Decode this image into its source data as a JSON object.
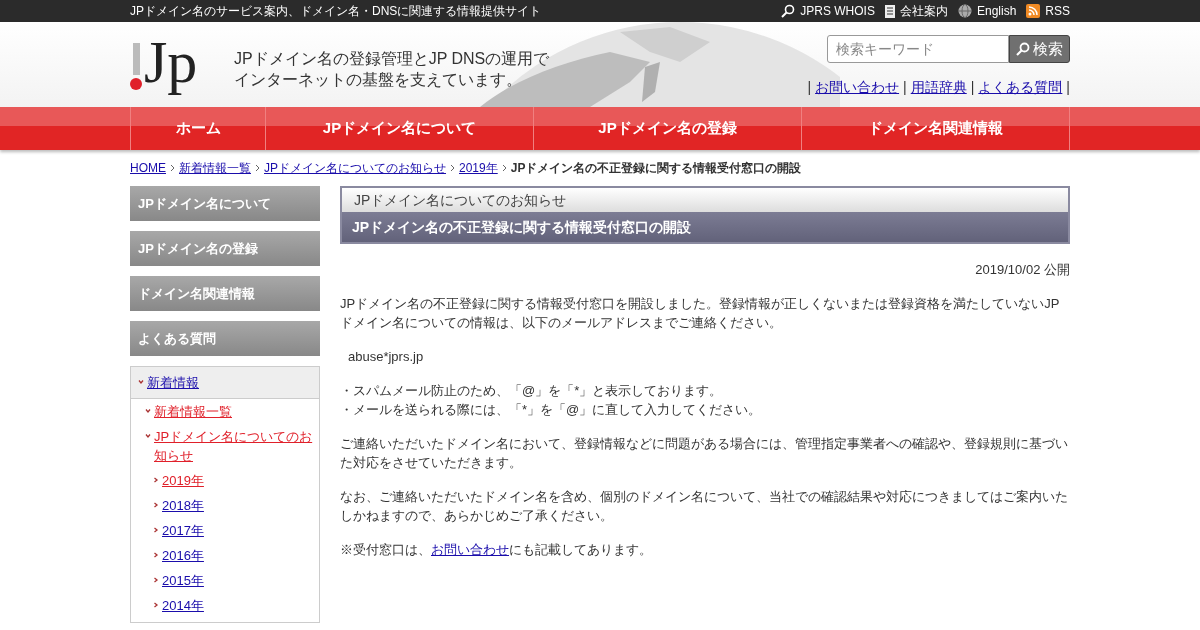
{
  "top_bar": {
    "tagline": "JPドメイン名のサービス案内、ドメイン名・DNSに関連する情報提供サイト",
    "links": [
      {
        "kind": "search",
        "label": "JPRS WHOIS"
      },
      {
        "kind": "document",
        "label": "会社案内"
      },
      {
        "kind": "globe",
        "label": "English"
      },
      {
        "kind": "rss",
        "label": "RSS"
      }
    ]
  },
  "header": {
    "logo": "Jp",
    "slogan": [
      "JPドメイン名の登録管理とJP DNSの運用で",
      "インターネットの基盤を支えています。"
    ],
    "search": {
      "placeholder": "検索キーワード",
      "button": "検索"
    },
    "links": [
      "お問い合わせ",
      "用語辞典",
      "よくある質問"
    ],
    "separator": "|"
  },
  "nav": [
    "ホーム",
    "JPドメイン名について",
    "JPドメイン名の登録",
    "ドメイン名関連情報"
  ],
  "breadcrumb": {
    "links": [
      "HOME",
      "新着情報一覧",
      "JPドメイン名についてのお知らせ",
      "2019年"
    ],
    "current": "JPドメイン名の不正登録に関する情報受付窓口の開設"
  },
  "sidebar": {
    "menu": [
      "JPドメイン名について",
      "JPドメイン名の登録",
      "ドメイン名関連情報",
      "よくある質問"
    ],
    "tree": [
      {
        "label": "新着情報",
        "selected": false,
        "expanded": true,
        "children": [
          {
            "label": "新着情報一覧",
            "selected": true,
            "expanded": true
          },
          {
            "label": "JPドメイン名についてのお知らせ",
            "selected": true,
            "expanded": true,
            "children": [
              {
                "label": "2019年",
                "selected": true,
                "expanded": false
              },
              {
                "label": "2018年",
                "selected": false,
                "expanded": false
              },
              {
                "label": "2017年",
                "selected": false,
                "expanded": false
              },
              {
                "label": "2016年",
                "selected": false,
                "expanded": false
              },
              {
                "label": "2015年",
                "selected": false,
                "expanded": false
              },
              {
                "label": "2014年",
                "selected": false,
                "expanded": false
              }
            ]
          }
        ]
      }
    ]
  },
  "article": {
    "category": "JPドメイン名についてのお知らせ",
    "title": "JPドメイン名の不正登録に関する情報受付窓口の開設",
    "date": "2019/10/02 公開",
    "blocks": [
      {
        "kind": "paragraph",
        "text": "JPドメイン名の不正登録に関する情報受付窓口を開設しました。登録情報が正しくないまたは登録資格を満たしていないJPドメイン名についての情報は、以下のメールアドレスまでご連絡ください。"
      },
      {
        "kind": "address",
        "text": "abuse*jprs.jp"
      },
      {
        "kind": "notes",
        "lines": [
          "・スパムメール防止のため、「@」を「*」と表示しております。",
          "・メールを送られる際には、「*」を「@」に直して入力してください。"
        ]
      },
      {
        "kind": "paragraph",
        "text": "ご連絡いただいたドメイン名において、登録情報などに問題がある場合には、管理指定事業者への確認や、登録規則に基づいた対応をさせていただきます。"
      },
      {
        "kind": "paragraph",
        "text": "なお、ご連絡いただいたドメイン名を含め、個別のドメイン名について、当社での確認結果や対応につきましてはご案内いたしかねますので、あらかじめご了承ください。"
      },
      {
        "kind": "link_paragraph",
        "before": "※受付窓口は、",
        "link": "お問い合わせ",
        "after": "にも記載してあります。"
      }
    ]
  }
}
